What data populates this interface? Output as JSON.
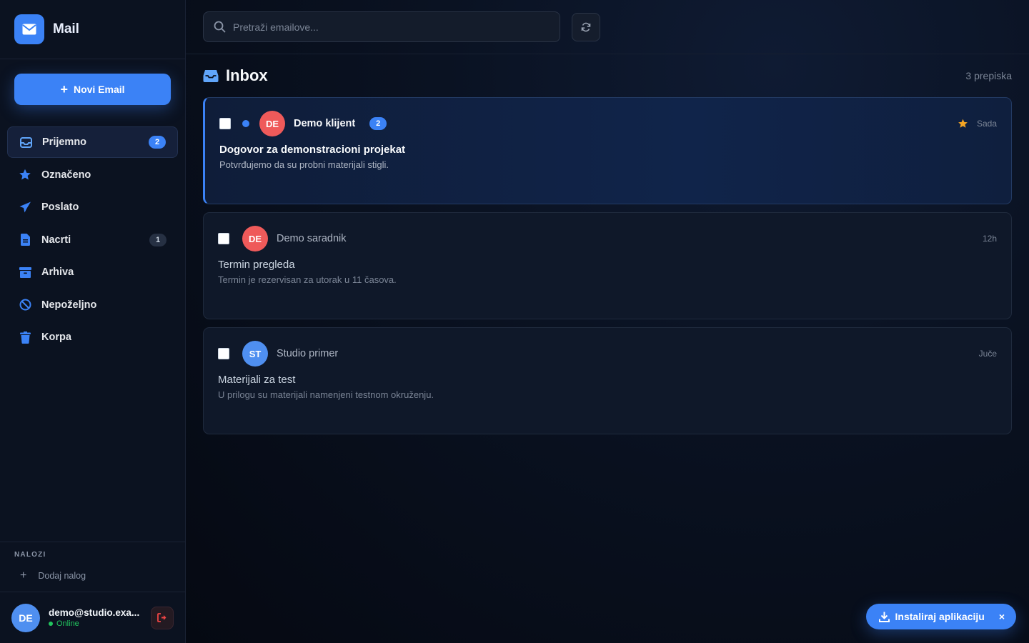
{
  "app": {
    "title": "Mail"
  },
  "sidebar": {
    "new_email_label": "Novi Email",
    "items": [
      {
        "label": "Prijemno",
        "icon": "inbox-icon",
        "badge": "2",
        "active": true
      },
      {
        "label": "Označeno",
        "icon": "star-icon",
        "badge": ""
      },
      {
        "label": "Poslato",
        "icon": "send-icon",
        "badge": ""
      },
      {
        "label": "Nacrti",
        "icon": "file-icon",
        "badge": "1"
      },
      {
        "label": "Arhiva",
        "icon": "archive-icon",
        "badge": ""
      },
      {
        "label": "Nepoželjno",
        "icon": "ban-icon",
        "badge": ""
      },
      {
        "label": "Korpa",
        "icon": "trash-icon",
        "badge": ""
      }
    ],
    "accounts_title": "NALOZI",
    "add_account_label": "Dodaj nalog",
    "user": {
      "initials": "DE",
      "email": "demo@studio.exa...",
      "status": "Online"
    }
  },
  "search": {
    "placeholder": "Pretraži emailove...",
    "value": ""
  },
  "inbox": {
    "title": "Inbox",
    "count": "3 prepiska",
    "emails": [
      {
        "initials": "DE",
        "sender": "Demo klijent",
        "thread_count": "2",
        "subject": "Dogovor za demonstracioni projekat",
        "preview": "Potvrđujemo da su probni materijali stigli.",
        "time": "Sada",
        "unread": true,
        "starred": true,
        "avatar_color": "#ef5a5a"
      },
      {
        "initials": "DE",
        "sender": "Demo saradnik",
        "thread_count": "",
        "subject": "Termin pregleda",
        "preview": "Termin je rezervisan za utorak u 11 časova.",
        "time": "12h",
        "unread": false,
        "starred": false,
        "avatar_color": "#ef5a5a"
      },
      {
        "initials": "ST",
        "sender": "Studio primer",
        "thread_count": "",
        "subject": "Materijali za test",
        "preview": "U prilogu su materijali namenjeni testnom okruženju.",
        "time": "Juče",
        "unread": false,
        "starred": false,
        "avatar_color": "#4f8ff0"
      }
    ]
  },
  "install": {
    "label": "Instaliraj aplikaciju",
    "close": "×"
  },
  "colors": {
    "accent": "#3b82f6",
    "star": "#f5a524",
    "online": "#22c55e",
    "logout": "#ef4444"
  }
}
